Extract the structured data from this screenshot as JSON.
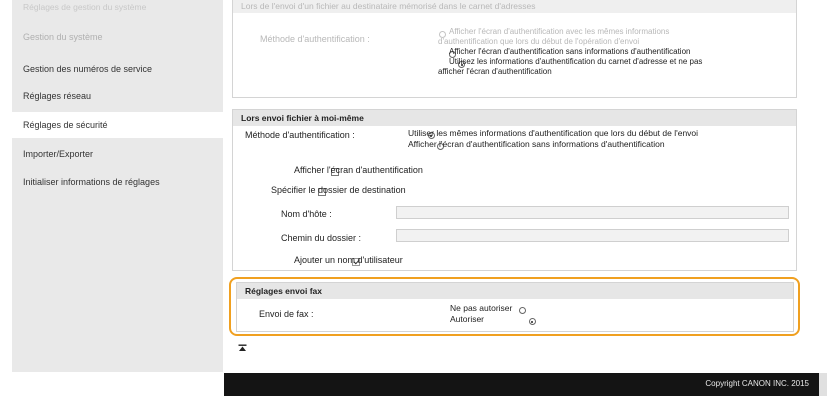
{
  "sidebar": {
    "header": "Réglages de gestion du système",
    "items": [
      {
        "label": "Gestion du système"
      },
      {
        "label": "Gestion des numéros de service"
      },
      {
        "label": "Réglages réseau"
      },
      {
        "label": "Réglages de sécurité"
      },
      {
        "label": "Importer/Exporter"
      },
      {
        "label": "Initialiser informations de réglages"
      }
    ]
  },
  "addressbook_section": {
    "title": "Lors de l'envoi d'un fichier au destinataire mémorisé dans le carnet d'adresses",
    "auth_label": "Méthode d'authentification :",
    "options": [
      {
        "line1": "Afficher l'écran d'authentification avec les mêmes informations",
        "line2": "d'authentification que lors du début de l'opération d'envoi"
      },
      {
        "line1": "Afficher l'écran d'authentification sans informations d'authentification",
        "line2": ""
      },
      {
        "line1": "Utilisez les informations d'authentification du carnet d'adresse et ne pas",
        "line2": "afficher l'écran d'authentification"
      }
    ]
  },
  "self_section": {
    "title": "Lors envoi fichier à moi-même",
    "auth_label": "Méthode d'authentification :",
    "option1": "Utiliser les mêmes informations d'authentification que lors du début de l'envoi",
    "option2": "Afficher l'écran d'authentification sans informations d'authentification",
    "show_auth_screen": "Afficher l'écran d'authentification",
    "specify_folder": "Spécifier le dossier de destination",
    "hostname_label": "Nom d'hôte :",
    "folder_path_label": "Chemin du dossier :",
    "add_username": "Ajouter un nom d'utilisateur"
  },
  "fax_section": {
    "title": "Réglages envoi fax",
    "fax_label": "Envoi de fax :",
    "option_deny": "Ne pas autoriser",
    "option_allow": "Autoriser"
  },
  "footer": {
    "copyright": "Copyright CANON INC. 2015",
    "top_icon": "scroll-to-top-icon"
  }
}
